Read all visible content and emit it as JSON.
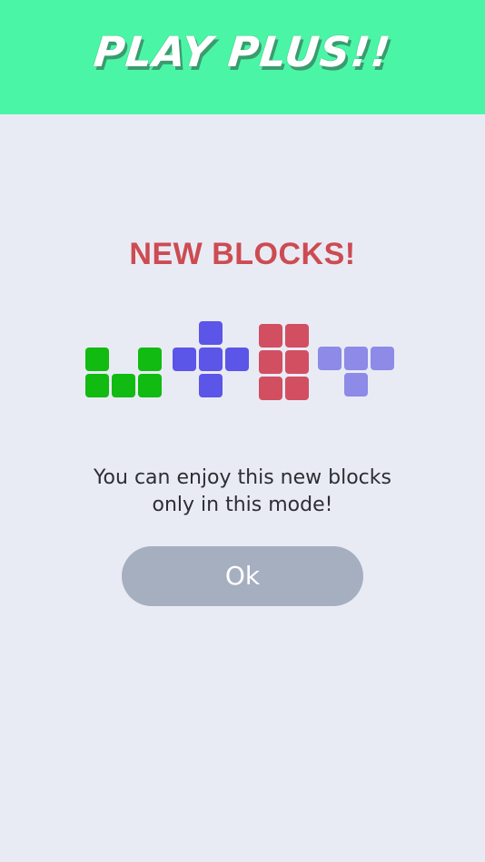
{
  "header": {
    "title": "PLAY PLUS!!"
  },
  "dialog": {
    "title": "NEW BLOCKS!",
    "title_color": "#cd4b52",
    "message_line1": "You can enjoy this new blocks",
    "message_line2": "only in this mode!",
    "ok_label": "Ok"
  },
  "colors": {
    "header_bg": "#4af6a6",
    "background": "#e9ebf4",
    "button_bg": "#a6afc0"
  },
  "blocks": [
    {
      "name": "green-u-piece",
      "color": "#11bb11",
      "pattern": [
        "X.X",
        "XXX"
      ]
    },
    {
      "name": "blue-plus-piece",
      "color": "#5b55e8",
      "pattern": [
        ".X.",
        "XXX",
        ".X."
      ]
    },
    {
      "name": "red-rect-piece",
      "color": "#d14f61",
      "pattern": [
        "XX",
        "XX",
        "XX"
      ]
    },
    {
      "name": "lavender-t-piece",
      "color": "#8d8ae8",
      "pattern": [
        "XXX",
        ".X."
      ]
    }
  ]
}
